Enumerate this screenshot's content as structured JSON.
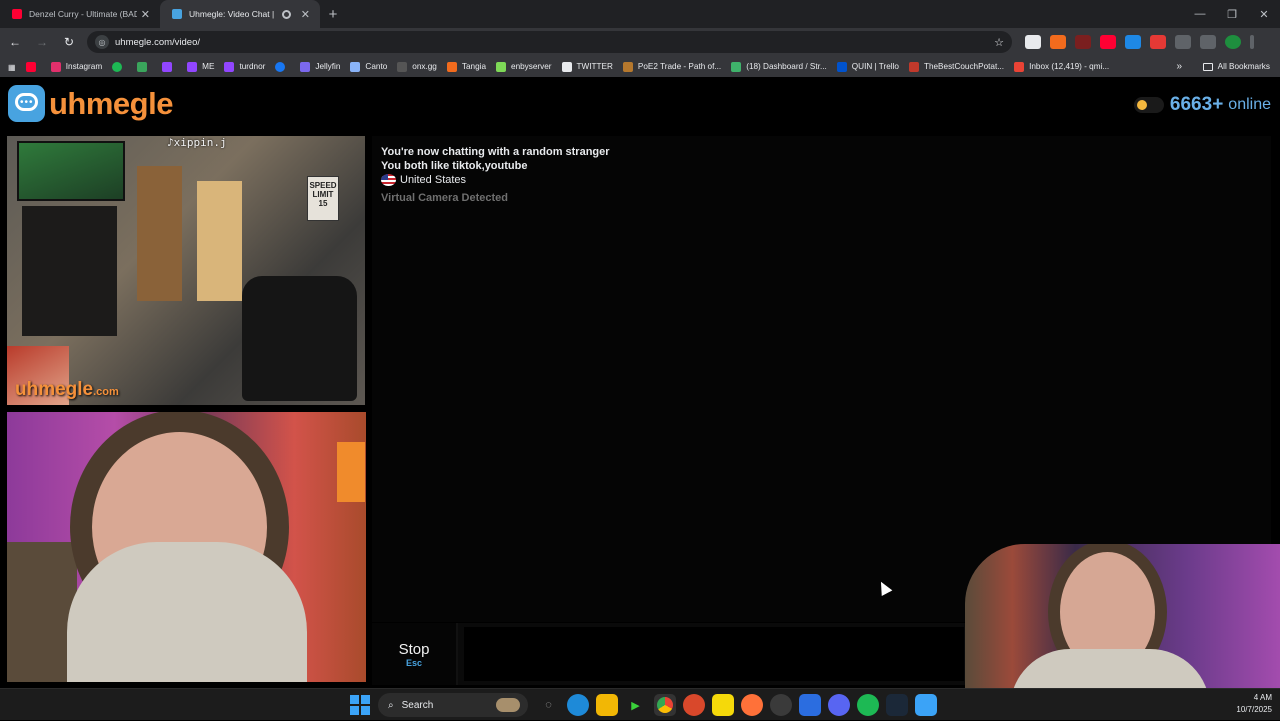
{
  "browser": {
    "tabs": [
      {
        "title": "Denzel Curry - Ultimate (BAD8",
        "active": false,
        "favicon_color": "#ff0033"
      },
      {
        "title": "Uhmegle: Video Chat | Onl",
        "active": true,
        "favicon_color": "#48a3e0"
      }
    ],
    "new_tab": "+",
    "window_controls": [
      "—",
      "❐",
      "✕"
    ],
    "url": "uhmegle.com/video/",
    "bookmarks": [
      {
        "label": "",
        "color": "#ff0033"
      },
      {
        "label": "Instagram",
        "color": "#e1306c"
      },
      {
        "label": "",
        "color": "#1db954"
      },
      {
        "label": "",
        "color": "#3aa55c"
      },
      {
        "label": "",
        "color": "#9146ff"
      },
      {
        "label": "ME",
        "color": "#9146ff"
      },
      {
        "label": "turdnor",
        "color": "#9146ff"
      },
      {
        "label": "",
        "color": "#1877f2"
      },
      {
        "label": "Jellyfin",
        "color": "#7b68ee"
      },
      {
        "label": "Canto",
        "color": "#8ab4f8"
      },
      {
        "label": "onx.gg",
        "color": "#222222"
      },
      {
        "label": "Tangia",
        "color": "#f26b1d"
      },
      {
        "label": "enbyserver",
        "color": "#7ed957"
      },
      {
        "label": "TWITTER",
        "color": "#000000"
      },
      {
        "label": "PoE2 Trade - Path of...",
        "color": "#b5782d"
      },
      {
        "label": "(18) Dashboard / Str...",
        "color": "#3fb26b"
      },
      {
        "label": "QUIN | Trello",
        "color": "#0052cc"
      },
      {
        "label": "TheBestCouchPotat...",
        "color": "#c0392b"
      },
      {
        "label": "Inbox (12,419) - qmi...",
        "color": "#ea4335"
      }
    ],
    "bookmarks_more": "»",
    "all_bookmarks": "All Bookmarks"
  },
  "site": {
    "logo_text": "uhmegle",
    "online_count": "6663+",
    "online_label": "online"
  },
  "video": {
    "stranger_overlay": "xippin.j",
    "watermark": "uhmegle",
    "watermark_suffix": ".com",
    "sign_text": "SPEED LIMIT 15"
  },
  "chat": {
    "messages": [
      "You're now chatting with a random stranger",
      "You both like tiktok,youtube",
      "United States",
      "Virtual Camera Detected"
    ],
    "stop_label": "Stop",
    "stop_shortcut": "Esc"
  },
  "taskbar": {
    "search_label": "Search",
    "time": "4 AM",
    "date": "10/7/2025"
  }
}
